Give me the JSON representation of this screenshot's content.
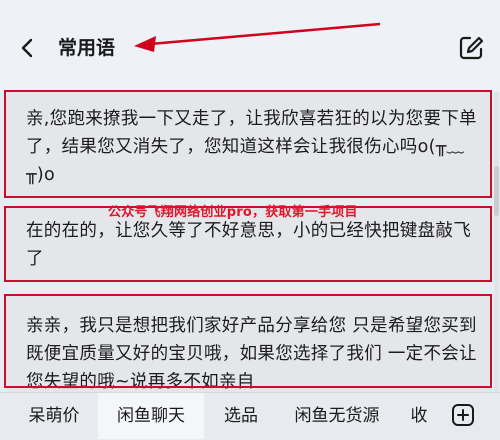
{
  "header": {
    "title": "常用语"
  },
  "phrases": [
    {
      "text": "亲,您跑来撩我一下又走了，让我欣喜若狂的以为您要下单了，结果您又消失了，您知道这样会让我很伤心吗o(╥﹏╥)o"
    },
    {
      "text": "在的在的，让您久等了不好意思，小的已经快把键盘敲飞了"
    },
    {
      "text": "亲亲，我只是想把我们家好产品分享给您 只是希望您买到既便宜质量又好的宝贝哦，如果您选择了我们 一定不会让您失望的哦~说再多不如亲自"
    }
  ],
  "watermark": "公众号飞翔网络创业pro，获取第一手项目",
  "tabs": [
    {
      "label": "呆萌价"
    },
    {
      "label": "闲鱼聊天",
      "active": true
    },
    {
      "label": "选品"
    },
    {
      "label": "闲鱼无货源"
    },
    {
      "label": "收"
    }
  ],
  "colors": {
    "annotation_red": "#c8102e",
    "background": "#e9edf2"
  }
}
